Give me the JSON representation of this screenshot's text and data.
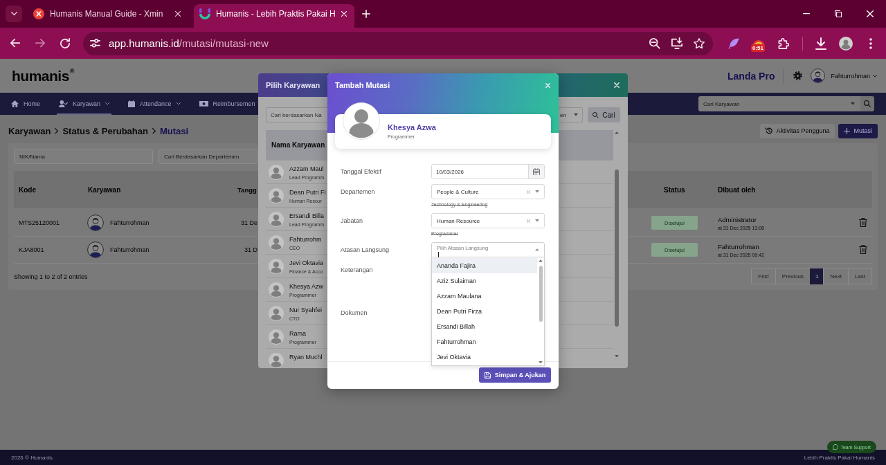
{
  "browser": {
    "tabs": [
      {
        "title": "Humanis Manual Guide - Xmin",
        "selected": false
      },
      {
        "title": "Humanis - Lebih Praktis Pakai H",
        "selected": true
      }
    ],
    "address": {
      "host": "app.humanis.id",
      "path": "/mutasi/mutasi-new"
    },
    "extension_badge": "0:51"
  },
  "app_header": {
    "logo": "humanis",
    "logo_mark": "®",
    "company": "Landa Pro",
    "user": "Fahturrohman"
  },
  "nav": {
    "items": [
      {
        "label": "Home",
        "has_menu": false,
        "selected": false
      },
      {
        "label": "Karyawan",
        "has_menu": true,
        "selected": true
      },
      {
        "label": "Attendance",
        "has_menu": true,
        "selected": false
      },
      {
        "label": "Reimbursemen",
        "has_menu": false,
        "selected": false
      }
    ],
    "search": {
      "placeholder": "Cari Karyawan"
    }
  },
  "breadcrumb": [
    {
      "label": "Karyawan",
      "current": false
    },
    {
      "label": "Status & Perubahan",
      "current": false
    },
    {
      "label": "Mutasi",
      "current": true
    }
  ],
  "actions": [
    {
      "kind": "outline",
      "label": "Aktivitas Pengguna"
    },
    {
      "kind": "primary",
      "label": "Mutasi"
    }
  ],
  "filters": [
    {
      "placeholder": "NIK/Nama"
    },
    {
      "placeholder": "Cari Berdasarkan Departemen"
    }
  ],
  "table": {
    "columns": [
      "Kode",
      "Karyawan",
      "Tangg",
      "Status",
      "Dibuat oleh"
    ],
    "rows": [
      {
        "code": "MTS25120001",
        "employee": "Fahturrohman",
        "column_3": "31 De",
        "status": "Disetujui",
        "created_by": "Administrator",
        "created_at": "at 31 Dec 2025 13:08"
      },
      {
        "code": "KJA8001",
        "employee": "Fahturrohman",
        "column_3": "31 D",
        "status": "Disetujui",
        "created_by": "Fahturrohman",
        "created_at": "at 31 Dec 2025 09:42"
      }
    ],
    "info": "Showing 1 to 2 of 2 entries"
  },
  "pagination": [
    {
      "label": "First",
      "selected": false,
      "disabled": true
    },
    {
      "label": "Previous",
      "selected": false,
      "disabled": true
    },
    {
      "label": "1",
      "selected": true,
      "disabled": false
    },
    {
      "label": "Next",
      "selected": false,
      "disabled": true
    },
    {
      "label": "Last",
      "selected": false,
      "disabled": true
    }
  ],
  "footer": {
    "copyright": "2026 © Humanis.",
    "tagline": "Lebih Praktis Pakai Humanis"
  },
  "support_button": {
    "label": "Team Support"
  },
  "employee_picker": {
    "title": "Pilih Karyawan",
    "search": {
      "placeholder": "Cari berdasarkan Na"
    },
    "filter_value": "en",
    "search_button": "Cari",
    "column": "Nama Karyawan",
    "employees": [
      {
        "name": "Azzam Maul",
        "position": "Lead Programm"
      },
      {
        "name": "Dean Putri Fi",
        "position": "Human Resour"
      },
      {
        "name": "Ersandi Billa",
        "position": "Lead Programm"
      },
      {
        "name": "Fahturrohm",
        "position": "CEO"
      },
      {
        "name": "Jevi Oktavia",
        "position": "Finance & Acco"
      },
      {
        "name": "Khesya Azw",
        "position": "Programmer"
      },
      {
        "name": "Nur Syahfei",
        "position": "CTO"
      },
      {
        "name": "Rama",
        "position": "Programmer"
      },
      {
        "name": "Ryan Muchl"
      }
    ]
  },
  "mutation_dialog": {
    "title": "Tambah Mutasi",
    "employee": {
      "name": "Khesya Azwa",
      "position": "Programmer"
    },
    "fields": [
      {
        "kind": "date",
        "label": "Tanggal Efektif",
        "value": "10/03/2026"
      },
      {
        "kind": "select",
        "label": "Departemen",
        "value": "People & Culture",
        "previous": "Technology & Engineering"
      },
      {
        "kind": "select",
        "label": "Jabatan",
        "value": "Human Resource",
        "previous": "Programmer"
      },
      {
        "kind": "combobox",
        "label": "Atasan Langsung",
        "placeholder": "Pilih Atasan Langsung",
        "expanded": true,
        "options": [
          {
            "label": "Ananda Fajira",
            "selected": true
          },
          {
            "label": "Aziz Sulaiman",
            "selected": false
          },
          {
            "label": "Azzam Maulana",
            "selected": false
          },
          {
            "label": "Dean Putri Firza",
            "selected": false
          },
          {
            "label": "Ersandi Billah",
            "selected": false
          },
          {
            "label": "Fahturrohman",
            "selected": false
          },
          {
            "label": "Jevi Oktavia",
            "selected": false
          }
        ]
      },
      {
        "kind": "textarea",
        "label": "Keterangan"
      },
      {
        "kind": "file",
        "label": "Dokumen"
      }
    ],
    "submit": "Simpan & Ajukan"
  }
}
